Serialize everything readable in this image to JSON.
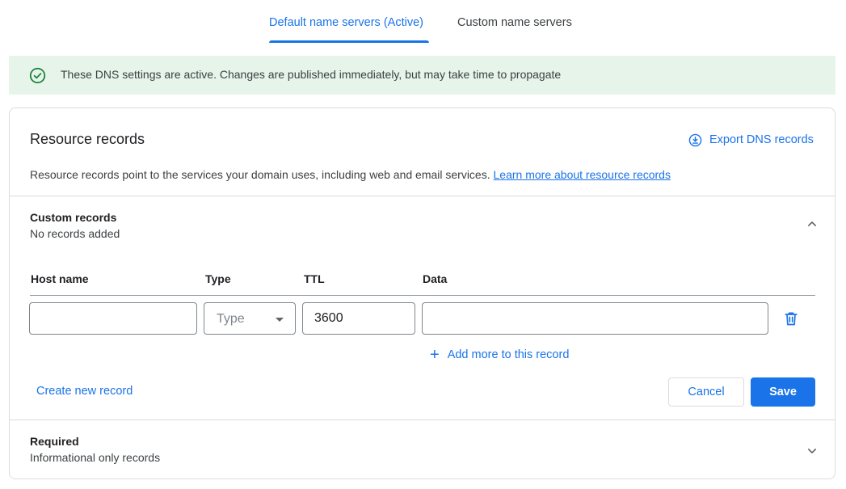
{
  "tabs": [
    {
      "label": "Default name servers (Active)",
      "active": true
    },
    {
      "label": "Custom name servers",
      "active": false
    }
  ],
  "banner": {
    "icon": "check-circle-icon",
    "message": "These DNS settings are active. Changes are published immediately, but may take time to propagate",
    "color": "#e6f4ea"
  },
  "resource_records": {
    "title": "Resource records",
    "export_label": "Export DNS records",
    "description": "Resource records point to the services your domain uses, including web and email services.",
    "learn_more": "Learn more about resource records"
  },
  "custom_records": {
    "title": "Custom records",
    "subtitle": "No records added",
    "columns": {
      "host": "Host name",
      "type": "Type",
      "ttl": "TTL",
      "data": "Data"
    },
    "row": {
      "host_value": "",
      "type_placeholder": "Type",
      "ttl_value": "3600",
      "data_value": ""
    },
    "add_more": "Add more to this record",
    "create_new": "Create new record",
    "cancel": "Cancel",
    "save": "Save"
  },
  "required": {
    "title": "Required",
    "subtitle": "Informational only records"
  },
  "colors": {
    "accent": "#1a73e8",
    "success": "#188038"
  }
}
